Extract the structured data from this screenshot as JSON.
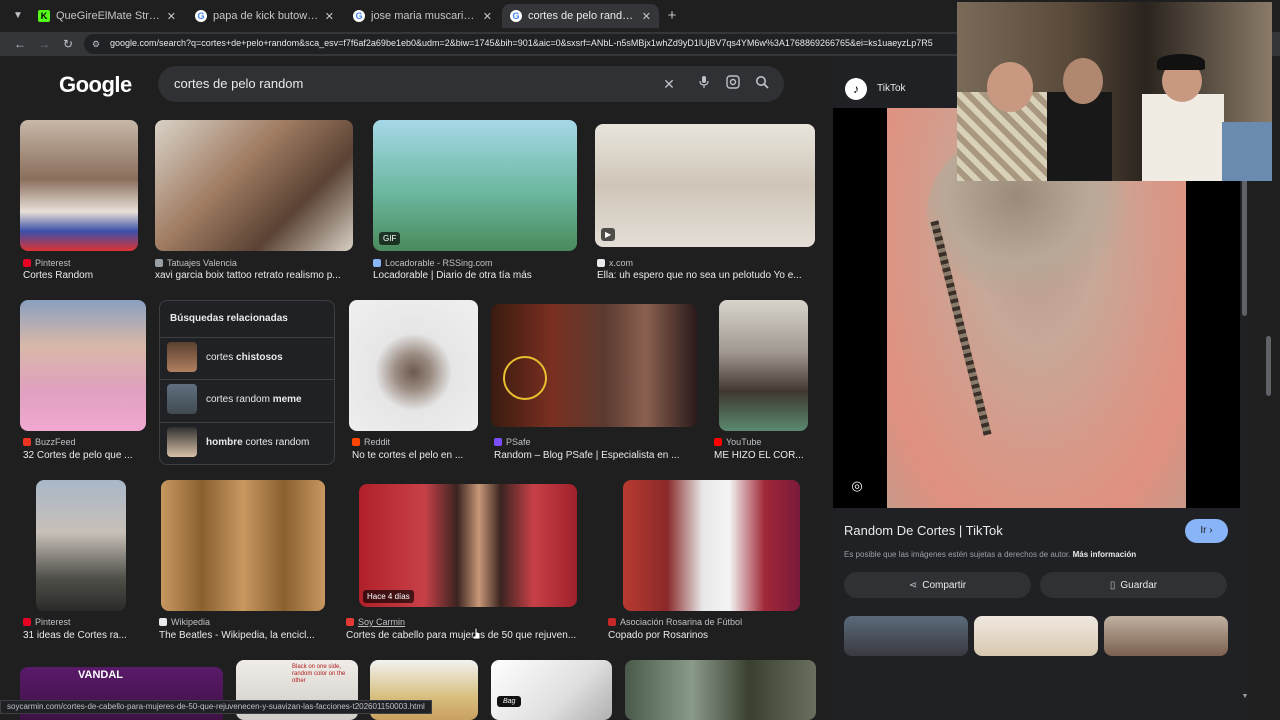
{
  "browser": {
    "tabs": [
      {
        "title": "QueGireElMate Stream - Kick D",
        "favicon": "K",
        "fav_color": "#53fc18",
        "active": false
      },
      {
        "title": "papa de kick butowski - Buscar",
        "favicon": "G",
        "fav_color": "#ffffff",
        "active": false
      },
      {
        "title": "jose maria muscari - Buscar con",
        "favicon": "G",
        "fav_color": "#ffffff",
        "active": false
      },
      {
        "title": "cortes de pelo random - Buscar",
        "favicon": "G",
        "fav_color": "#ffffff",
        "active": true
      }
    ],
    "url": "google.com/search?q=cortes+de+pelo+random&sca_esv=f7f6af2a69be1eb0&udm=2&biw=1745&bih=901&aic=0&sxsrf=ANbL-n5sMBjx1whZd9yD1lUjBV7qs4YM6w%3A1768869266765&ei=ks1uaeyzLp7R5"
  },
  "search": {
    "logo": "Google",
    "query": "cortes de pelo random"
  },
  "results": [
    {
      "source": "Pinterest",
      "title": "Cortes Random",
      "src_color": "#e60023"
    },
    {
      "source": "Tatuajes Valencia",
      "title": "xavi garcia boix tattoo retrato realismo p...",
      "src_color": "#9aa0a6"
    },
    {
      "source": "Locadorable - RSSing.com",
      "title": "Locadorable | Diario de otra tía más",
      "src_color": "#8ab4f8",
      "badge": "GIF"
    },
    {
      "source": "x.com",
      "title": "Ella: uh espero que no sea un pelotudo Yo e...",
      "src_color": "#e8eaed",
      "badge": "▶"
    },
    {
      "source": "BuzzFeed",
      "title": "32 Cortes de pelo que ...",
      "src_color": "#ee3322"
    },
    {
      "source": "Reddit",
      "title": "No te cortes el pelo en ...",
      "src_color": "#ff4500"
    },
    {
      "source": "PSafe",
      "title": "Random – Blog PSafe | Especialista en ...",
      "src_color": "#7b4dff"
    },
    {
      "source": "YouTube",
      "title": "ME HIZO EL COR...",
      "src_color": "#ff0000"
    },
    {
      "source": "Pinterest",
      "title": "31 ideas de Cortes ra...",
      "src_color": "#e60023"
    },
    {
      "source": "Wikipedia",
      "title": "The Beatles - Wikipedia, la encicl...",
      "src_color": "#e8eaed"
    },
    {
      "source": "Soy Carmin",
      "title": "Cortes de cabello para mujeres de 50 que rejuven...",
      "src_color": "#e53935",
      "badge": "Hace 4 días"
    },
    {
      "source": "Asociación Rosarina de Fútbol",
      "title": "Copado por Rosarinos",
      "src_color": "#c62828"
    }
  ],
  "related": {
    "heading": "Búsquedas relacionadas",
    "items": [
      {
        "plain": "cortes ",
        "bold": "chistosos"
      },
      {
        "plain": "cortes random ",
        "bold": "meme"
      },
      {
        "bold": "hombre",
        "plain": " cortes random"
      }
    ]
  },
  "panel": {
    "source": "TikTok",
    "title": "Random De Cortes | TikTok",
    "go_label": "Ir",
    "note": "Es posible que las imágenes estén sujetas a derechos de autor.",
    "note_link": "Más información",
    "share_label": "Compartir",
    "save_label": "Guardar"
  },
  "statusbar": "soycarmin.com/cortes-de-cabello-para-mujeres-de-50-que-rejuvenecen-y-suavizan-las-facciones-t202601150003.html",
  "bottom_row": {
    "vandal_label": "VANDAL",
    "shirt_text": "Black on one side, random color on the other",
    "bag_label": "Bag"
  }
}
